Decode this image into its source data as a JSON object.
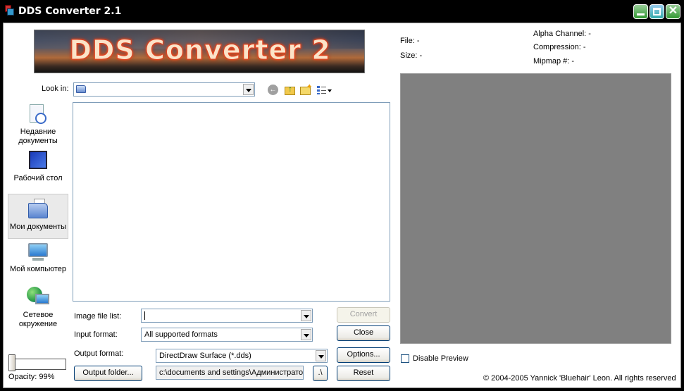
{
  "window": {
    "title": "DDS Converter 2.1",
    "banner_text": "DDS Converter 2"
  },
  "dialog": {
    "look_in_label": "Look in:",
    "look_in_value": "",
    "places": [
      {
        "label": "Недавние документы",
        "icon": "recent-documents-icon"
      },
      {
        "label": "Рабочий стол",
        "icon": "desktop-icon"
      },
      {
        "label": "Мои документы",
        "icon": "my-documents-icon",
        "selected": true
      },
      {
        "label": "Мой компьютер",
        "icon": "my-computer-icon"
      },
      {
        "label": "Сетевое окружение",
        "icon": "network-icon"
      }
    ],
    "image_file_list_label": "Image file list:",
    "image_file_list_value": "",
    "input_format_label": "Input format:",
    "input_format_value": "All supported formats",
    "output_format_label": "Output format:",
    "output_format_value": "DirectDraw Surface (*.dds)",
    "output_folder_button": "Output folder...",
    "output_folder_path": "c:\\documents and settings\\Администратор",
    "up_dir_button": ".\\"
  },
  "buttons": {
    "convert": "Convert",
    "close": "Close",
    "options": "Options...",
    "reset": "Reset"
  },
  "opacity": {
    "label": "Opacity: 99%",
    "value_percent": 99
  },
  "info": {
    "file": "File: -",
    "size": "Size: -",
    "alpha_channel": "Alpha Channel: -",
    "compression": "Compression: -",
    "mipmap": "Mipmap #: -"
  },
  "preview": {
    "disable_label": "Disable Preview",
    "disabled": false,
    "background": "#808080"
  },
  "copyright": "© 2004-2005 Yannick 'Bluehair' Leon. All rights reserved"
}
